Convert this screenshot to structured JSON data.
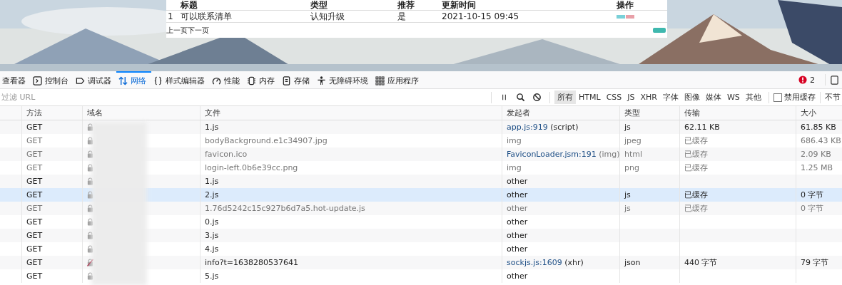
{
  "page": {
    "table": {
      "columns": [
        "标题",
        "类型",
        "推荐",
        "更新时间",
        "操作"
      ],
      "rows": [
        {
          "index": "1",
          "title": "可以联系清单",
          "type": "认知升级",
          "recommended": "是",
          "updated": "2021-10-15 09:45"
        }
      ]
    },
    "pagination": [
      "上一页",
      "下一页"
    ]
  },
  "devtools": {
    "tools": [
      {
        "label": "查看器",
        "selected": false
      },
      {
        "label": "控制台",
        "selected": false
      },
      {
        "label": "调试器",
        "selected": false
      },
      {
        "label": "网络",
        "selected": true
      },
      {
        "label": "样式编辑器",
        "selected": false
      },
      {
        "label": "性能",
        "selected": false
      },
      {
        "label": "内存",
        "selected": false
      },
      {
        "label": "存储",
        "selected": false
      },
      {
        "label": "无障碍环境",
        "selected": false
      },
      {
        "label": "应用程序",
        "selected": false
      }
    ],
    "error_count": "2",
    "filter": {
      "placeholder": "过滤 URL"
    },
    "type_filters": [
      {
        "label": "所有",
        "selected": true
      },
      {
        "label": "HTML",
        "selected": false
      },
      {
        "label": "CSS",
        "selected": false
      },
      {
        "label": "JS",
        "selected": false
      },
      {
        "label": "XHR",
        "selected": false
      },
      {
        "label": "字体",
        "selected": false
      },
      {
        "label": "图像",
        "selected": false
      },
      {
        "label": "媒体",
        "selected": false
      },
      {
        "label": "WS",
        "selected": false
      },
      {
        "label": "其他",
        "selected": false
      }
    ],
    "disable_cache": {
      "label": "禁用缓存",
      "checked": false
    },
    "throttle": "不节",
    "columns": [
      "方法",
      "域名",
      "文件",
      "发起者",
      "类型",
      "传输",
      "大小"
    ],
    "rows": [
      {
        "method": "GET",
        "secure": true,
        "file": "1.js",
        "initiator_link": "app.js:919",
        "initiator_suffix": " (script)",
        "type": "js",
        "transferred": "62.11 KB",
        "size": "61.85 KB",
        "cached": false,
        "selected": false
      },
      {
        "method": "GET",
        "secure": true,
        "file": "bodyBackground.e1c34907.jpg",
        "initiator_link": "",
        "initiator_suffix": "img",
        "type": "jpeg",
        "transferred": "已缓存",
        "size": "686.43 KB",
        "cached": true,
        "selected": false
      },
      {
        "method": "GET",
        "secure": true,
        "file": "favicon.ico",
        "initiator_link": "FaviconLoader.jsm:191",
        "initiator_suffix": " (img)",
        "type": "html",
        "transferred": "已缓存",
        "size": "2.09 KB",
        "cached": true,
        "selected": false
      },
      {
        "method": "GET",
        "secure": true,
        "file": "login-left.0b6e39cc.png",
        "initiator_link": "",
        "initiator_suffix": "img",
        "type": "png",
        "transferred": "已缓存",
        "size": "1.25 MB",
        "cached": true,
        "selected": false
      },
      {
        "method": "GET",
        "secure": true,
        "file": "1.js",
        "initiator_link": "",
        "initiator_suffix": "other",
        "type": "",
        "transferred": "",
        "size": "",
        "cached": false,
        "selected": false
      },
      {
        "method": "GET",
        "secure": true,
        "file": "2.js",
        "initiator_link": "",
        "initiator_suffix": "other",
        "type": "js",
        "transferred": "已缓存",
        "size": "0 字节",
        "cached": false,
        "selected": true
      },
      {
        "method": "GET",
        "secure": true,
        "file": "1.76d5242c15c927b6d7a5.hot-update.js",
        "initiator_link": "",
        "initiator_suffix": "other",
        "type": "js",
        "transferred": "已缓存",
        "size": "0 字节",
        "cached": true,
        "selected": false
      },
      {
        "method": "GET",
        "secure": true,
        "file": "0.js",
        "initiator_link": "",
        "initiator_suffix": "other",
        "type": "",
        "transferred": "",
        "size": "",
        "cached": false,
        "selected": false
      },
      {
        "method": "GET",
        "secure": true,
        "file": "3.js",
        "initiator_link": "",
        "initiator_suffix": "other",
        "type": "",
        "transferred": "",
        "size": "",
        "cached": false,
        "selected": false
      },
      {
        "method": "GET",
        "secure": true,
        "file": "4.js",
        "initiator_link": "",
        "initiator_suffix": "other",
        "type": "",
        "transferred": "",
        "size": "",
        "cached": false,
        "selected": false
      },
      {
        "method": "GET",
        "secure": false,
        "file": "info?t=1638280537641",
        "initiator_link": "sockjs.js:1609",
        "initiator_suffix": " (xhr)",
        "type": "json",
        "transferred": "440 字节",
        "size": "79 字节",
        "cached": false,
        "selected": false
      },
      {
        "method": "GET",
        "secure": true,
        "file": "5.js",
        "initiator_link": "",
        "initiator_suffix": "other",
        "type": "",
        "transferred": "",
        "size": "",
        "cached": false,
        "selected": false
      }
    ]
  }
}
